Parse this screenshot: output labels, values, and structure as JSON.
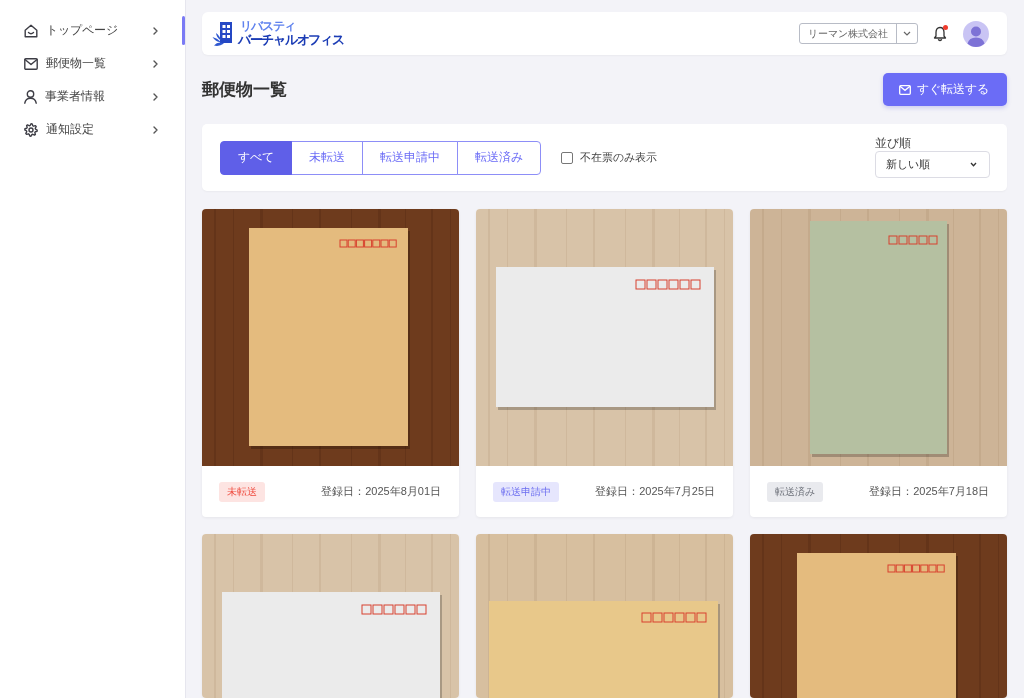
{
  "sidebar": {
    "items": [
      {
        "label": "トップページ",
        "selected": true
      },
      {
        "label": "郵便物一覧",
        "selected": false
      },
      {
        "label": "事業者情報",
        "selected": false
      },
      {
        "label": "通知設定",
        "selected": false
      }
    ]
  },
  "header": {
    "logo": {
      "tagline": "リバスティ",
      "name": "バーチャルオフィス"
    },
    "company_select": {
      "value": "リーマン株式会社"
    },
    "notifications": {
      "unread": true
    }
  },
  "page": {
    "title": "郵便物一覧",
    "action_button": "すぐ転送する"
  },
  "filters": {
    "tabs": [
      {
        "label": "すべて",
        "selected": true
      },
      {
        "label": "未転送",
        "selected": false
      },
      {
        "label": "転送申請中",
        "selected": false
      },
      {
        "label": "転送済み",
        "selected": false
      }
    ],
    "absence_only": {
      "label": "不在票のみ表示",
      "checked": false
    },
    "sort": {
      "label": "並び順",
      "value": "新しい順"
    }
  },
  "mail_items": [
    {
      "kind": "kraft",
      "status": {
        "label": "未転送",
        "kind": "pending",
        "color": "#fde4e2"
      },
      "registered": "登録日：2025年8月01日"
    },
    {
      "kind": "white",
      "status": {
        "label": "転送申請中",
        "kind": "requested",
        "color": "#e6e6fd"
      },
      "registered": "登録日：2025年7月25日"
    },
    {
      "kind": "green",
      "status": {
        "label": "転送済み",
        "kind": "forwarded",
        "color": "#e9eaee"
      },
      "registered": "登録日：2025年7月18日"
    },
    {
      "kind": "white"
    },
    {
      "kind": "manila"
    },
    {
      "kind": "kraft"
    }
  ]
}
